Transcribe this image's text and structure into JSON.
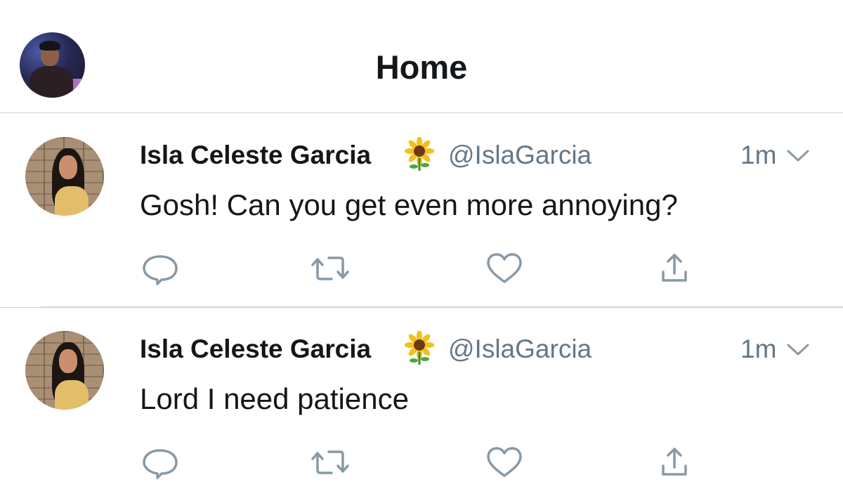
{
  "header": {
    "title": "Home",
    "avatar_icon": "profile-avatar"
  },
  "tweets": [
    {
      "name": "Isla Celeste Garcia",
      "emoji": "sunflower-emoji",
      "handle": "@IslaGarcia",
      "time": "1m",
      "text": "Gosh! Can you get even more annoying?",
      "actions": [
        "reply-icon",
        "retweet-icon",
        "like-icon",
        "share-icon"
      ]
    },
    {
      "name": "Isla Celeste Garcia",
      "emoji": "sunflower-emoji",
      "handle": "@IslaGarcia",
      "time": "1m",
      "text": "Lord I need patience",
      "actions": [
        "reply-icon",
        "retweet-icon",
        "like-icon",
        "share-icon"
      ]
    }
  ],
  "colors": {
    "text_primary": "#14171a",
    "text_secondary": "#657786",
    "icon_gray": "#8899a6",
    "divider": "#cfd2d6"
  }
}
